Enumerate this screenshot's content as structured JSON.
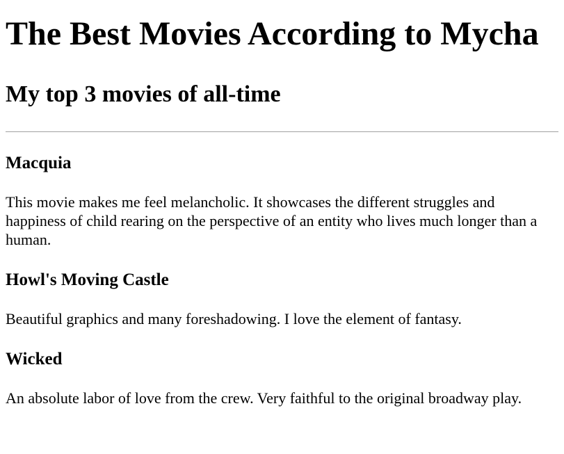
{
  "page": {
    "title": "The Best Movies According to Mycha",
    "subtitle": "My top 3 movies of all-time"
  },
  "movies": [
    {
      "title": "Macquia",
      "description": "This movie makes me feel melancholic. It showcases the different struggles and happiness of child rearing on the perspective of an entity who lives much longer than a human."
    },
    {
      "title": "Howl's Moving Castle",
      "description": "Beautiful graphics and many foreshadowing. I love the element of fantasy."
    },
    {
      "title": "Wicked",
      "description": "An absolute labor of love from the crew. Very faithful to the original broadway play."
    }
  ]
}
